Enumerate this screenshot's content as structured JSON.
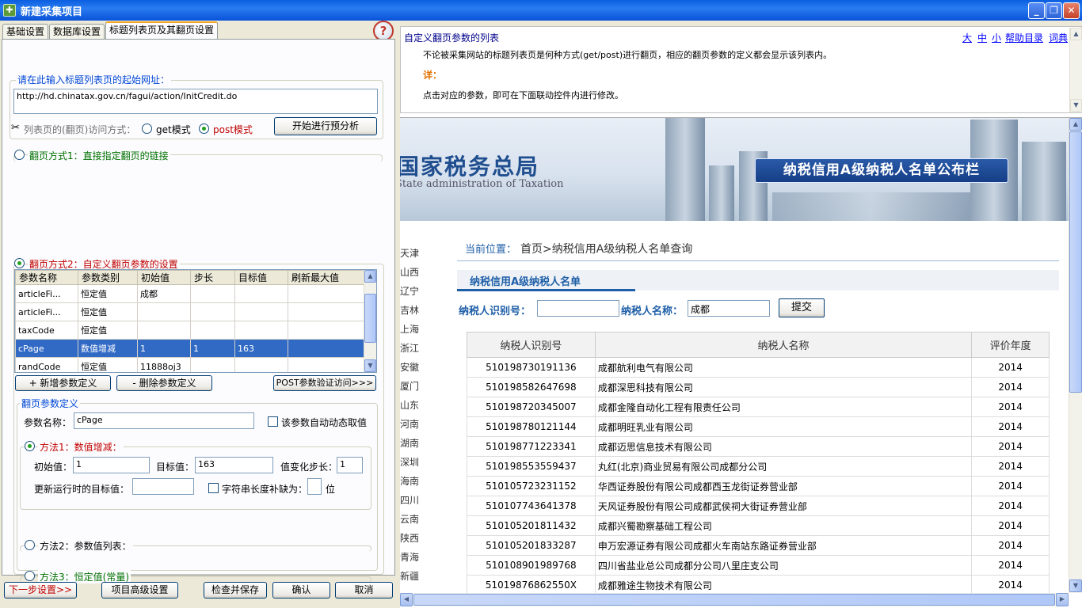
{
  "window": {
    "title": "新建采集项目",
    "buttons": {
      "minimize": "_",
      "maximize": "❐",
      "close": "✕"
    }
  },
  "tabs": [
    {
      "label": "基础设置"
    },
    {
      "label": "数据库设置"
    },
    {
      "label": "标题列表页及其翻页设置",
      "active": true
    }
  ],
  "start_url": {
    "label": "请在此输入标题列表页的起始网址：",
    "value": "http://hd.chinatax.gov.cn/fagui/action/InitCredit.do"
  },
  "access_mode": {
    "label": "列表页的(翻页)访问方式：",
    "get": "get模式",
    "post": "post模式",
    "selected": "post",
    "analyze_button": "开始进行预分析"
  },
  "paging1": {
    "label": "翻页方式1：直接指定翻页的链接"
  },
  "paging2": {
    "label": "翻页方式2：自定义翻页参数的设置"
  },
  "param_table": {
    "headers": [
      "参数名称",
      "参数类别",
      "初始值",
      "步长",
      "目标值",
      "刷新最大值"
    ],
    "rows": [
      [
        "articleFi...",
        "恒定值",
        "成都",
        "",
        "",
        ""
      ],
      [
        "articleFi...",
        "恒定值",
        "",
        "",
        "",
        ""
      ],
      [
        "taxCode",
        "恒定值",
        "",
        "",
        "",
        ""
      ],
      [
        "cPage",
        "数值增减",
        "1",
        "1",
        "163",
        ""
      ],
      [
        "randCode",
        "恒定值",
        "11888oj3",
        "",
        "",
        ""
      ]
    ],
    "selected_row": 3
  },
  "param_buttons": {
    "add": "+ 新增参数定义",
    "remove": "- 删除参数定义",
    "verify": "POST参数验证访问>>>"
  },
  "param_def": {
    "title": "翻页参数定义",
    "name_label": "参数名称：",
    "name_value": "cPage",
    "auto_dynamic": "该参数自动动态取值"
  },
  "method1": {
    "label": "方法1：数值增减：",
    "initial_label": "初始值：",
    "initial_value": "1",
    "target_label": "目标值：",
    "target_value": "163",
    "step_label": "值变化步长：",
    "step_value": "1",
    "update_label": "更新运行时的目标值：",
    "update_value": "",
    "pad_label": "字符串长度补缺为：",
    "pad_unit": "位"
  },
  "method2": {
    "label": "方法2：参数值列表："
  },
  "method3": {
    "label": "方法3：恒定值(常量)"
  },
  "bottom_buttons": {
    "next": "下一步设置>>",
    "advanced": "项目高级设置",
    "check_save": "检查并保存",
    "ok": "确认",
    "cancel": "取消"
  },
  "help_panel": {
    "title": "自定义翻页参数的列表",
    "links": [
      "大",
      "中",
      "小",
      "帮助目录",
      "词典"
    ],
    "line1": "不论被采集网站的标题列表页是何种方式(get/post)进行翻页，相应的翻页参数的定义都会显示该列表内。",
    "detail": "详：",
    "line2": "点击对应的参数，即可在下面联动控件内进行修改。"
  },
  "web": {
    "banner_title": "国家税务总局",
    "banner_sub": "State administration of Taxation",
    "banner_plate": "纳税信用A级纳税人名单公布栏",
    "provinces": [
      "天津",
      "山西",
      "辽宁",
      "吉林",
      "上海",
      "浙江",
      "安徽",
      "厦门",
      "山东",
      "河南",
      "湖南",
      "深圳",
      "海南",
      "四川",
      "云南",
      "陕西",
      "青海",
      "新疆"
    ],
    "location_label": "当前位置：",
    "location_path": "首页>纳税信用A级纳税人名单查询",
    "section_title": "纳税信用A级纳税人名单",
    "id_label": "纳税人识别号：",
    "id_value": "",
    "name_label": "纳税人名称：",
    "name_value": "成都",
    "submit": "提交",
    "headers": [
      "纳税人识别号",
      "纳税人名称",
      "评价年度"
    ],
    "rows": [
      [
        "510198730191136",
        "成都航利电气有限公司",
        "2014"
      ],
      [
        "510198582647698",
        "成都深思科技有限公司",
        "2014"
      ],
      [
        "510198720345007",
        "成都金隆自动化工程有限责任公司",
        "2014"
      ],
      [
        "510198780121144",
        "成都明旺乳业有限公司",
        "2014"
      ],
      [
        "510198771223341",
        "成都迈思信息技术有限公司",
        "2014"
      ],
      [
        "510198553559437",
        "丸红(北京)商业贸易有限公司成都分公司",
        "2014"
      ],
      [
        "510105723231152",
        "华西证券股份有限公司成都西玉龙街证券营业部",
        "2014"
      ],
      [
        "510107743641378",
        "天风证券股份有限公司成都武侯祠大街证券营业部",
        "2014"
      ],
      [
        "510105201811432",
        "成都兴蜀勘察基础工程公司",
        "2014"
      ],
      [
        "510105201833287",
        "申万宏源证券有限公司成都火车南站东路证券营业部",
        "2014"
      ],
      [
        "510108901989768",
        "四川省盐业总公司成都分公司八里庄支公司",
        "2014"
      ],
      [
        "51019876862550X",
        "成都雅途生物技术有限公司",
        "2014"
      ]
    ]
  }
}
